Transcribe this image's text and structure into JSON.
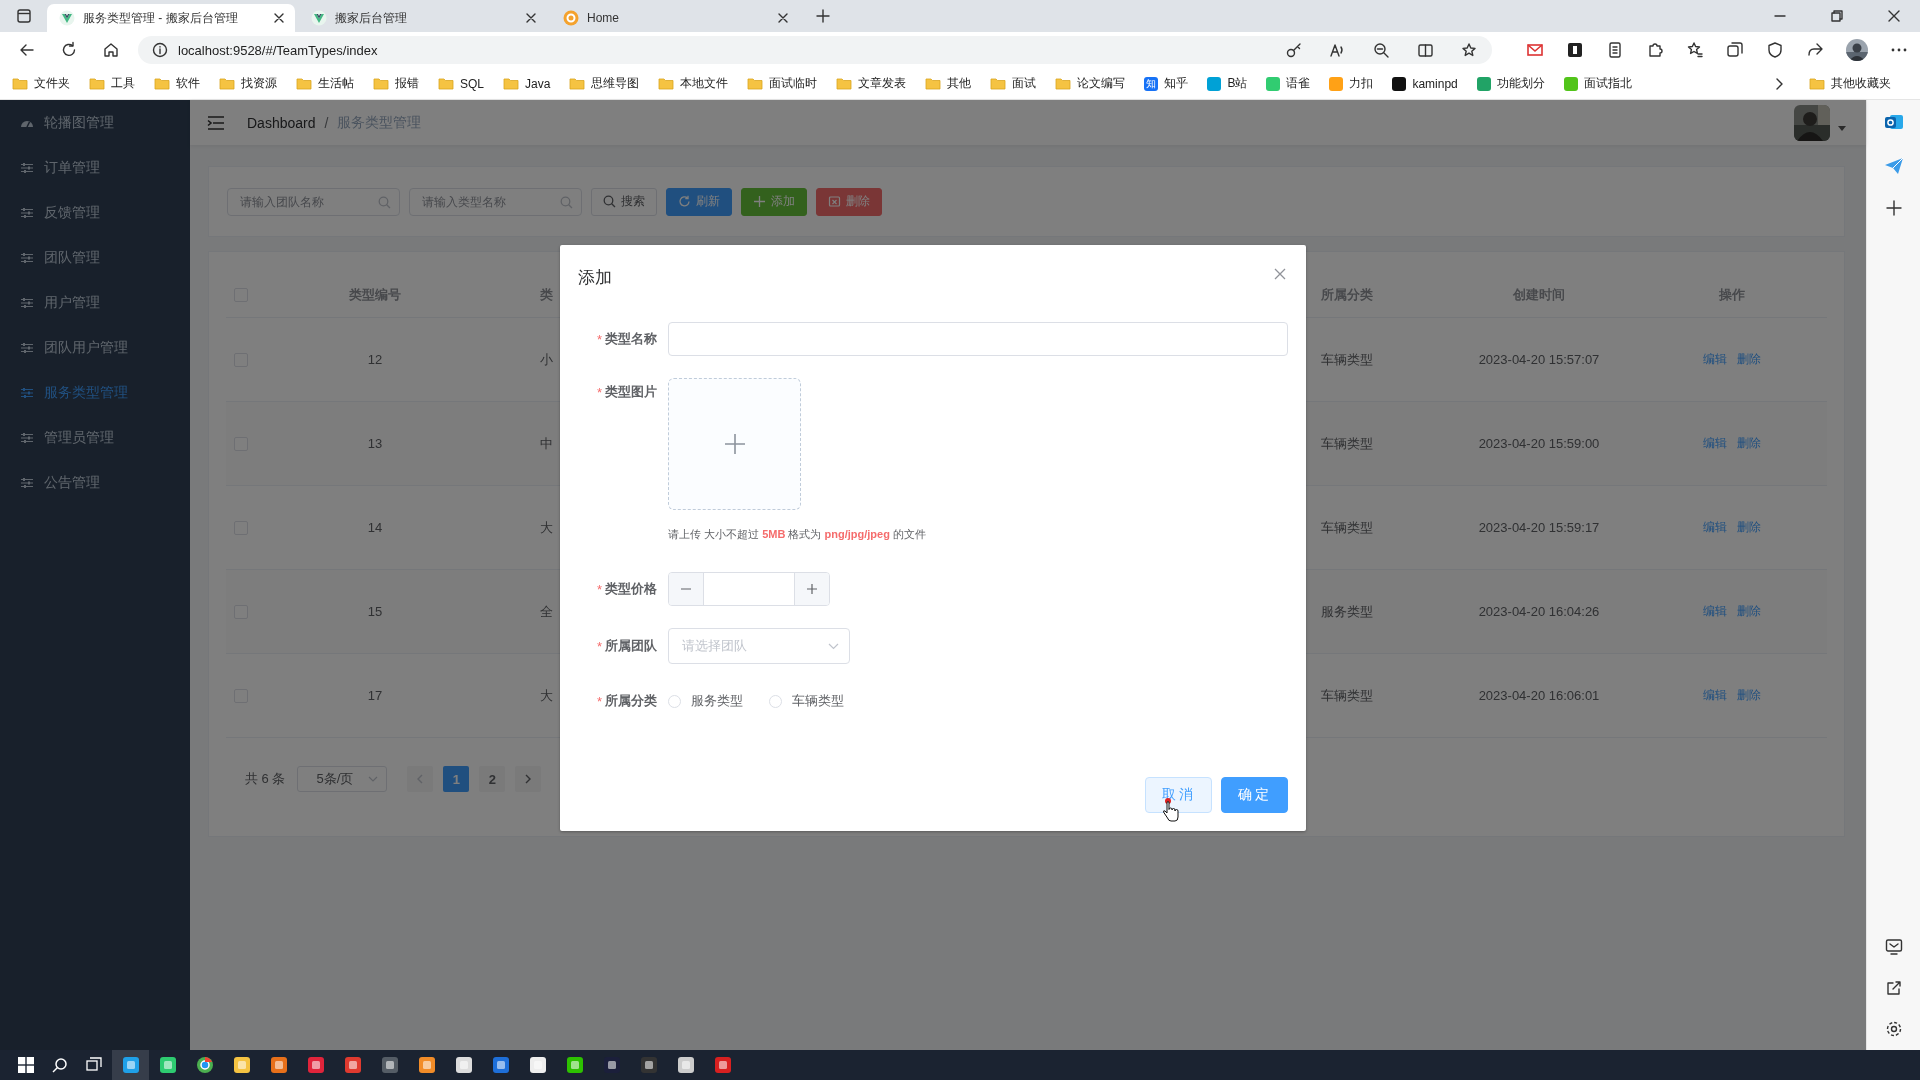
{
  "browser": {
    "tabs": [
      {
        "title": "服务类型管理 - 搬家后台管理",
        "kind": "vue",
        "selected": true
      },
      {
        "title": "搬家后台管理",
        "kind": "vue",
        "selected": false
      },
      {
        "title": "Home",
        "kind": "ring",
        "selected": false
      }
    ],
    "url": "localhost:9528/#/TeamTypes/index",
    "bookmarks": [
      {
        "label": "文件夹",
        "kind": "folder"
      },
      {
        "label": "工具",
        "kind": "folder"
      },
      {
        "label": "软件",
        "kind": "folder"
      },
      {
        "label": "找资源",
        "kind": "folder"
      },
      {
        "label": "生活帖",
        "kind": "folder"
      },
      {
        "label": "报错",
        "kind": "folder"
      },
      {
        "label": "SQL",
        "kind": "folder"
      },
      {
        "label": "Java",
        "kind": "folder"
      },
      {
        "label": "思维导图",
        "kind": "folder"
      },
      {
        "label": "本地文件",
        "kind": "folder"
      },
      {
        "label": "面试临时",
        "kind": "folder"
      },
      {
        "label": "文章发表",
        "kind": "folder"
      },
      {
        "label": "其他",
        "kind": "folder"
      },
      {
        "label": "面试",
        "kind": "folder"
      },
      {
        "label": "论文编写",
        "kind": "folder"
      },
      {
        "label": "知乎",
        "kind": "site",
        "color": "#1772f6",
        "badge": "知"
      },
      {
        "label": "B站",
        "kind": "site",
        "color": "#00a1d6"
      },
      {
        "label": "语雀",
        "kind": "site",
        "color": "#31cc71"
      },
      {
        "label": "力扣",
        "kind": "site",
        "color": "#ffa116"
      },
      {
        "label": "kaminpd",
        "kind": "site",
        "color": "#111111"
      },
      {
        "label": "功能划分",
        "kind": "site",
        "color": "#21a366"
      },
      {
        "label": "面试指北",
        "kind": "site",
        "color": "#52c41a"
      }
    ],
    "other_bookmarks": "其他收藏夹"
  },
  "sidebar": {
    "items": [
      {
        "label": "轮播图管理",
        "kind": "dashboard",
        "selected": false
      },
      {
        "label": "订单管理",
        "kind": "menu",
        "selected": false
      },
      {
        "label": "反馈管理",
        "kind": "menu",
        "selected": false
      },
      {
        "label": "团队管理",
        "kind": "menu",
        "selected": false
      },
      {
        "label": "用户管理",
        "kind": "menu",
        "selected": false
      },
      {
        "label": "团队用户管理",
        "kind": "menu",
        "selected": false
      },
      {
        "label": "服务类型管理",
        "kind": "menu",
        "selected": true
      },
      {
        "label": "管理员管理",
        "kind": "menu",
        "selected": false
      },
      {
        "label": "公告管理",
        "kind": "menu",
        "selected": false
      }
    ]
  },
  "header": {
    "breadcrumb": [
      "Dashboard",
      "服务类型管理"
    ],
    "separator": "/"
  },
  "toolbar": {
    "fields": [
      {
        "placeholder": "请输入团队名称"
      },
      {
        "placeholder": "请输入类型名称"
      }
    ],
    "buttons": [
      {
        "label": "搜索",
        "kind": "default"
      },
      {
        "label": "刷新",
        "kind": "primary"
      },
      {
        "label": "添加",
        "kind": "success"
      },
      {
        "label": "删除",
        "kind": "danger"
      }
    ]
  },
  "table": {
    "header_checked": false,
    "columns": [
      "类型编号",
      "类",
      "所属分类",
      "创建时间",
      "操作"
    ],
    "rows": [
      {
        "checked": false,
        "cells": [
          "12",
          "小",
          "车辆类型",
          "2023-04-20 15:57:07"
        ],
        "actions": [
          "编辑",
          "删除"
        ]
      },
      {
        "checked": false,
        "cells": [
          "13",
          "中",
          "车辆类型",
          "2023-04-20 15:59:00"
        ],
        "actions": [
          "编辑",
          "删除"
        ]
      },
      {
        "checked": false,
        "cells": [
          "14",
          "大",
          "车辆类型",
          "2023-04-20 15:59:17"
        ],
        "actions": [
          "编辑",
          "删除"
        ]
      },
      {
        "checked": false,
        "cells": [
          "15",
          "全",
          "服务类型",
          "2023-04-20 16:04:26"
        ],
        "actions": [
          "编辑",
          "删除"
        ]
      },
      {
        "checked": false,
        "cells": [
          "17",
          "大",
          "车辆类型",
          "2023-04-20 16:06:01"
        ],
        "actions": [
          "编辑",
          "删除"
        ]
      }
    ]
  },
  "pagination": {
    "total": "共 6 条",
    "page_size": "5条/页",
    "pages": [
      {
        "label": "1",
        "selected": true
      },
      {
        "label": "2",
        "selected": false
      }
    ]
  },
  "dialog": {
    "title": "添加",
    "fields": [
      {
        "kind": "text",
        "marker": "*",
        "label": "类型名称"
      },
      {
        "kind": "upload",
        "marker": "*",
        "label": "类型图片",
        "hint": "请上传 大小不超过 **5MB** 格式为 **png/jpg/jpeg** 的文件"
      },
      {
        "kind": "number",
        "marker": "*",
        "label": "类型价格"
      },
      {
        "kind": "select",
        "marker": "*",
        "label": "所属团队",
        "placeholder": "请选择团队"
      },
      {
        "kind": "radio",
        "marker": "*",
        "label": "所属分类",
        "options": [
          {
            "label": "服务类型",
            "selected": false
          },
          {
            "label": "车辆类型",
            "selected": false
          }
        ]
      }
    ],
    "buttons": [
      {
        "label": "取消",
        "kind": "default",
        "hovered": true
      },
      {
        "label": "确定",
        "kind": "primary",
        "hovered": false
      }
    ]
  }
}
